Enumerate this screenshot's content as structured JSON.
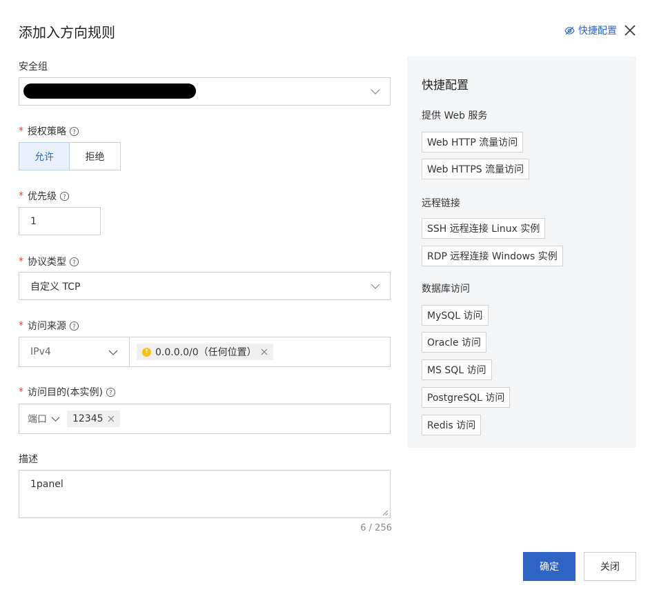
{
  "dialog": {
    "title": "添加入方向规则",
    "quick_config_link": "快捷配置"
  },
  "form": {
    "security_group": {
      "label": "安全组"
    },
    "policy": {
      "label": "授权策略",
      "options": [
        "允许",
        "拒绝"
      ],
      "selected": "允许"
    },
    "priority": {
      "label": "优先级",
      "value": "1"
    },
    "protocol": {
      "label": "协议类型",
      "value": "自定义 TCP"
    },
    "source": {
      "label": "访问来源",
      "ip_type": "IPv4",
      "tag": "0.0.0.0/0（任何位置）",
      "tag_icon": "!"
    },
    "destination": {
      "label": "访问目的(本实例)",
      "port_label": "端口",
      "port_value": "12345"
    },
    "description": {
      "label": "描述",
      "value": "1panel",
      "counter": "6 / 256"
    }
  },
  "quick_panel": {
    "title": "快捷配置",
    "sections": [
      {
        "title": "提供 Web 服务",
        "items": [
          "Web HTTP 流量访问",
          "Web HTTPS 流量访问"
        ]
      },
      {
        "title": "远程链接",
        "items": [
          "SSH 远程连接 Linux 实例",
          "RDP 远程连接 Windows 实例"
        ]
      },
      {
        "title": "数据库访问",
        "items": [
          "MySQL 访问",
          "Oracle 访问",
          "MS SQL 访问",
          "PostgreSQL 访问",
          "Redis 访问"
        ]
      }
    ]
  },
  "footer": {
    "confirm": "确定",
    "close": "关闭"
  },
  "colors": {
    "primary": "#2f64c5",
    "required": "#e6442e",
    "warning": "#f5c218",
    "panel_bg": "#f4f5f7"
  }
}
